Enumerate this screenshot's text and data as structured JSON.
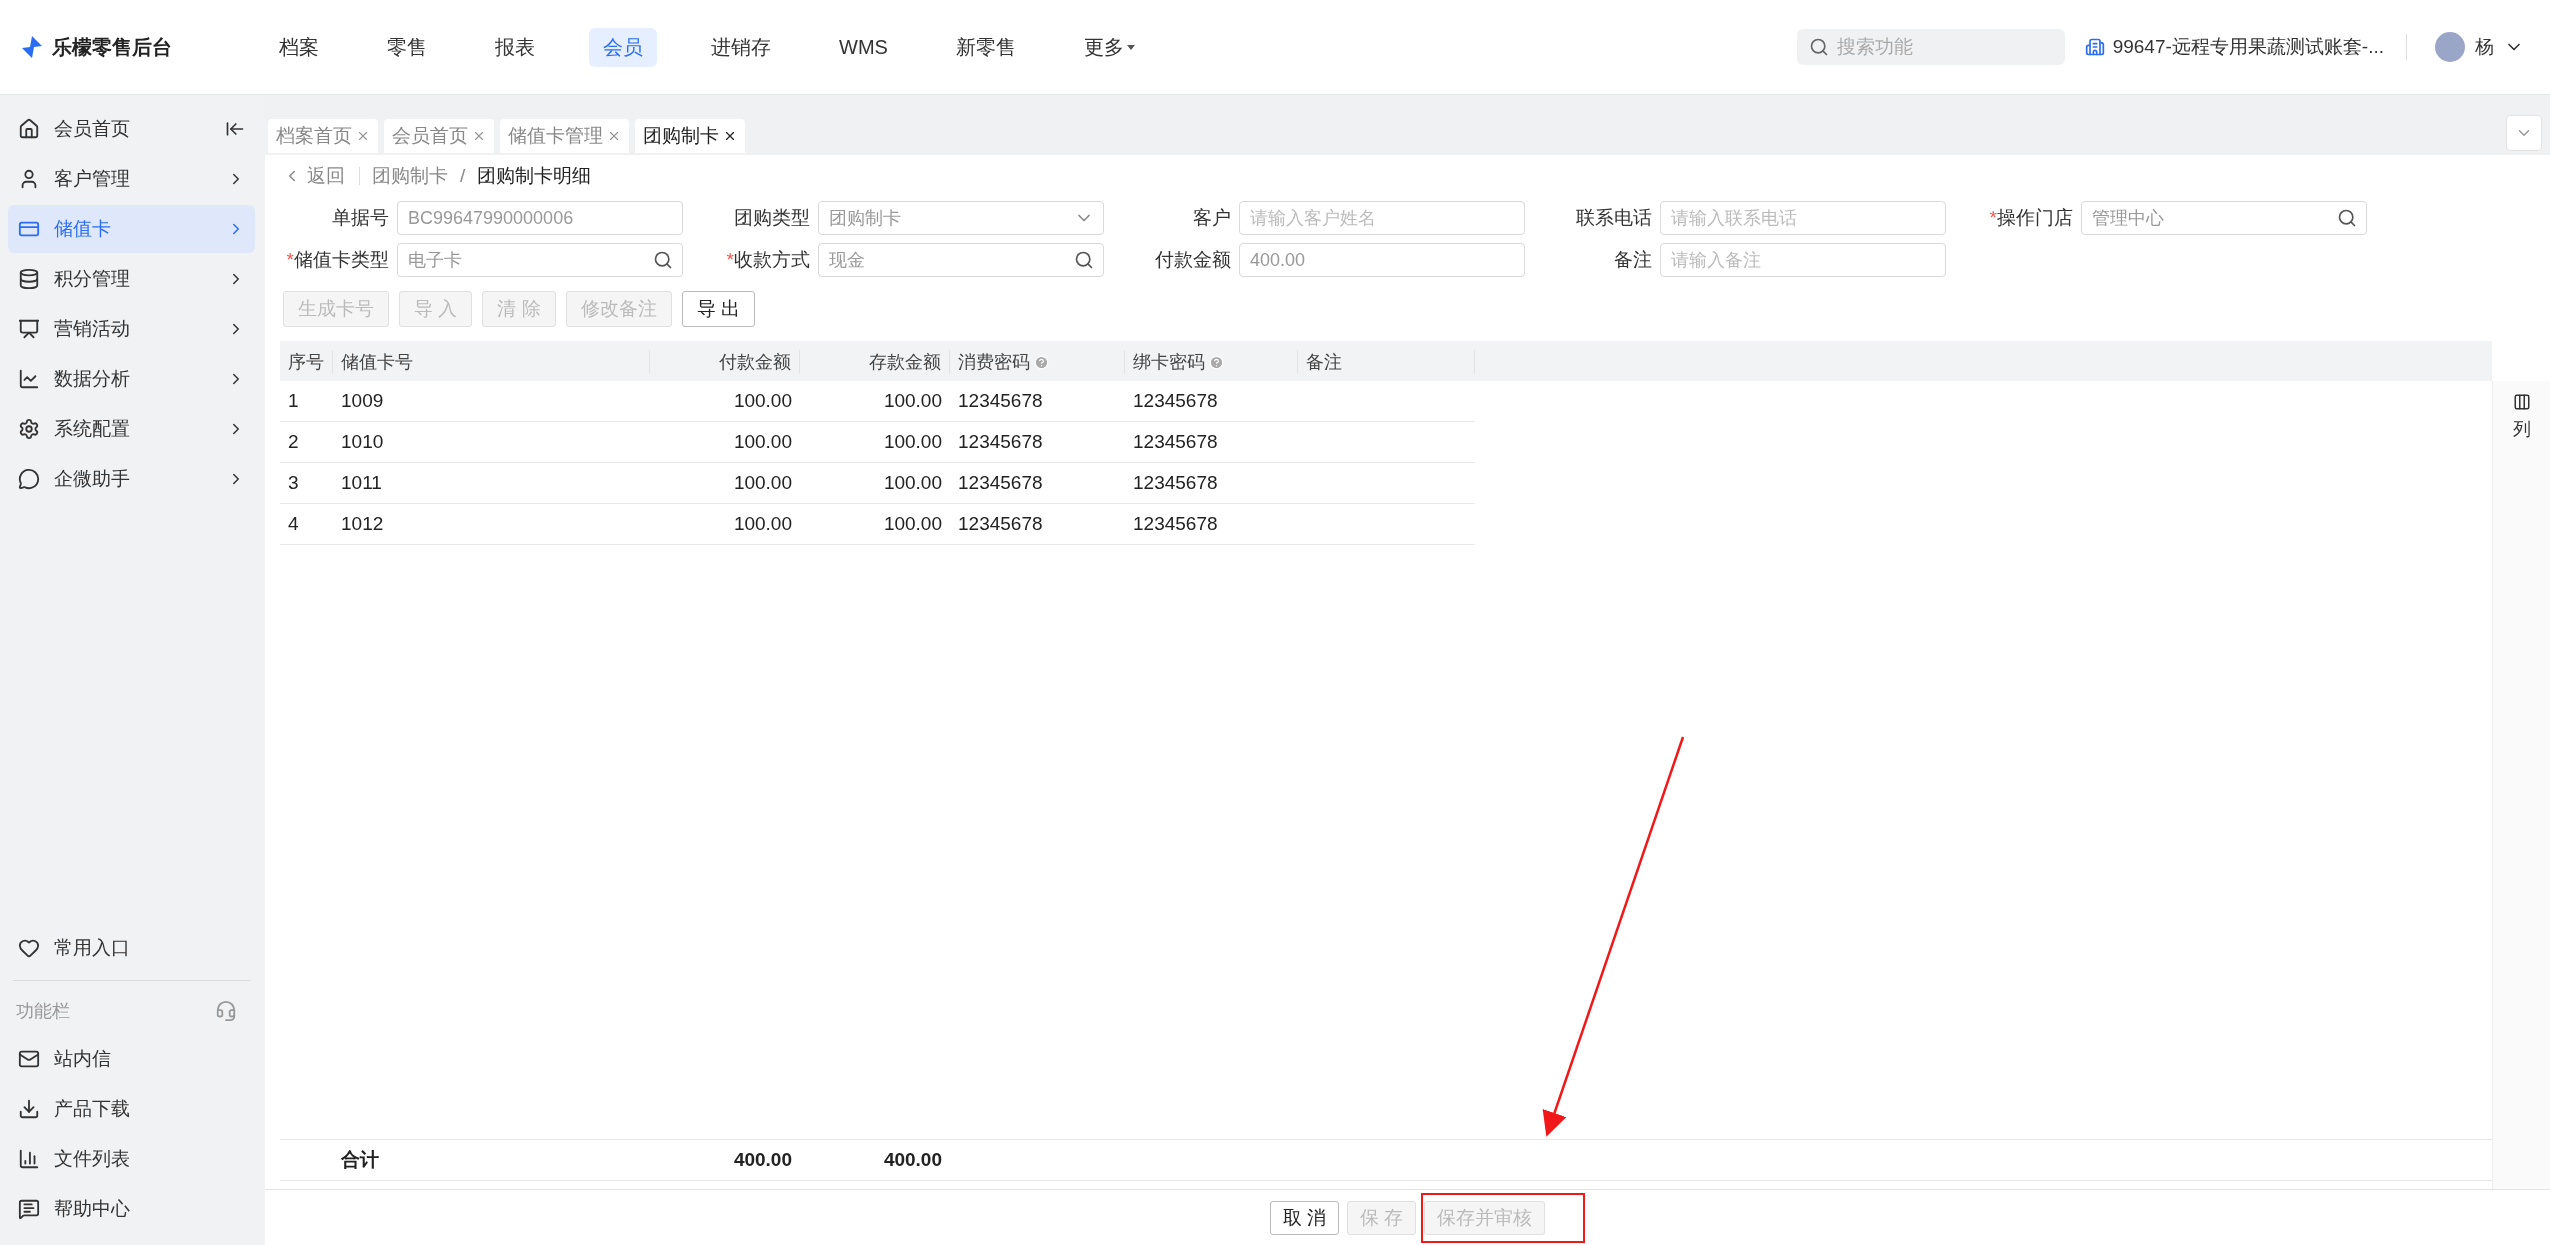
{
  "app": {
    "logo_text": "乐檬零售后台"
  },
  "top_nav": [
    {
      "label": "档案",
      "selected": false,
      "kind": "link"
    },
    {
      "label": "零售",
      "selected": false,
      "kind": "link"
    },
    {
      "label": "报表",
      "selected": false,
      "kind": "link"
    },
    {
      "label": "会员",
      "selected": true,
      "kind": "link"
    },
    {
      "label": "进销存",
      "selected": false,
      "kind": "link"
    },
    {
      "label": "WMS",
      "selected": false,
      "kind": "link"
    },
    {
      "label": "新零售",
      "selected": false,
      "kind": "link"
    },
    {
      "label": "更多",
      "selected": false,
      "kind": "menu"
    }
  ],
  "search": {
    "placeholder": "搜索功能"
  },
  "account": {
    "name": "99647-远程专用果蔬测试账套-..."
  },
  "user": {
    "name": "杨"
  },
  "sidebar": {
    "items": [
      {
        "label": "会员首页",
        "selected": false,
        "kind": "collapse"
      },
      {
        "label": "客户管理",
        "selected": false,
        "kind": "group"
      },
      {
        "label": "储值卡",
        "selected": true,
        "kind": "group"
      },
      {
        "label": "积分管理",
        "selected": false,
        "kind": "group"
      },
      {
        "label": "营销活动",
        "selected": false,
        "kind": "group"
      },
      {
        "label": "数据分析",
        "selected": false,
        "kind": "group"
      },
      {
        "label": "系统配置",
        "selected": false,
        "kind": "group"
      },
      {
        "label": "企微助手",
        "selected": false,
        "kind": "group"
      }
    ],
    "favorites": {
      "label": "常用入口"
    },
    "tools": {
      "title": "功能栏",
      "items": [
        {
          "label": "站内信"
        },
        {
          "label": "产品下载"
        },
        {
          "label": "文件列表"
        },
        {
          "label": "帮助中心"
        }
      ]
    }
  },
  "tabs": [
    {
      "label": "档案首页",
      "selected": false
    },
    {
      "label": "会员首页",
      "selected": false
    },
    {
      "label": "储值卡管理",
      "selected": false
    },
    {
      "label": "团购制卡",
      "selected": true
    }
  ],
  "breadcrumb": {
    "back": "返回",
    "separator": "/",
    "items": [
      "团购制卡",
      "团购制卡明细"
    ]
  },
  "form": {
    "required_mark": "*",
    "fields": [
      {
        "label": "单据号",
        "required": false,
        "kind": "text",
        "value": "BC99647990000006"
      },
      {
        "label": "团购类型",
        "required": false,
        "kind": "select",
        "value": "团购制卡"
      },
      {
        "label": "客户",
        "required": false,
        "kind": "text",
        "placeholder": "请输入客户姓名"
      },
      {
        "label": "联系电话",
        "required": false,
        "kind": "text",
        "placeholder": "请输入联系电话"
      },
      {
        "label": "操作门店",
        "required": true,
        "kind": "search",
        "value": "管理中心"
      },
      {
        "label": "储值卡类型",
        "required": true,
        "kind": "search",
        "value": "电子卡"
      },
      {
        "label": "收款方式",
        "required": true,
        "kind": "search",
        "value": "现金"
      },
      {
        "label": "付款金额",
        "required": false,
        "kind": "text",
        "value": "400.00"
      },
      {
        "label": "备注",
        "required": false,
        "kind": "text",
        "placeholder": "请输入备注"
      }
    ]
  },
  "toolbar": [
    {
      "label": "生成卡号",
      "disabled": true
    },
    {
      "label": "导 入",
      "disabled": true
    },
    {
      "label": "清 除",
      "disabled": true
    },
    {
      "label": "修改备注",
      "disabled": true
    },
    {
      "label": "导 出",
      "disabled": false
    }
  ],
  "table": {
    "columns": [
      {
        "label": "序号",
        "kind": "text",
        "help": false
      },
      {
        "label": "储值卡号",
        "kind": "text",
        "help": false
      },
      {
        "label": "付款金额",
        "kind": "amount",
        "help": false
      },
      {
        "label": "存款金额",
        "kind": "amount",
        "help": false
      },
      {
        "label": "消费密码",
        "kind": "text",
        "help": true
      },
      {
        "label": "绑卡密码",
        "kind": "text",
        "help": true
      },
      {
        "label": "备注",
        "kind": "text",
        "help": false
      }
    ],
    "rows": [
      [
        "1",
        "1009",
        "100.00",
        "100.00",
        "12345678",
        "12345678"
      ],
      [
        "2",
        "1010",
        "100.00",
        "100.00",
        "12345678",
        "12345678"
      ],
      [
        "3",
        "1011",
        "100.00",
        "100.00",
        "12345678",
        "12345678"
      ],
      [
        "4",
        "1012",
        "100.00",
        "100.00",
        "12345678",
        "12345678"
      ]
    ],
    "summary": {
      "label": "合计",
      "payment": "400.00",
      "deposit": "400.00"
    },
    "column_settings": {
      "label": "列"
    }
  },
  "footer": [
    {
      "label": "取 消",
      "disabled": false
    },
    {
      "label": "保 存",
      "disabled": true
    },
    {
      "label": "保存并审核",
      "disabled": true
    }
  ]
}
